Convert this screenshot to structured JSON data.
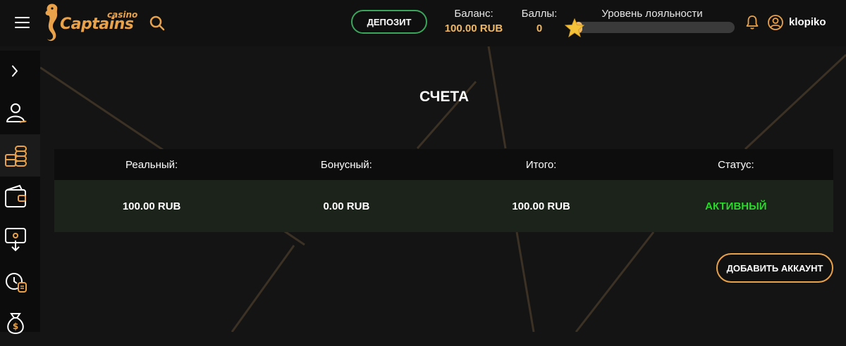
{
  "header": {
    "logo_small": "casino",
    "logo_main": "Captains",
    "deposit_label": "ДЕПОЗИТ",
    "balance_label": "Баланс:",
    "balance_value": "100.00 RUB",
    "points_label": "Баллы:",
    "points_value": "0",
    "loyalty_label": "Уровень лояльности",
    "loyalty_progress_fraction": 0.05,
    "username": "klopiko"
  },
  "sidebar": {
    "items": [
      {
        "icon": "chevron-right-icon"
      },
      {
        "icon": "user-profile-icon"
      },
      {
        "icon": "coins-stack-icon",
        "active": true
      },
      {
        "icon": "wallet-icon"
      },
      {
        "icon": "withdraw-icon"
      },
      {
        "icon": "history-icon"
      },
      {
        "icon": "money-bag-icon"
      }
    ]
  },
  "main": {
    "title": "СЧЕТА",
    "table": {
      "headers": [
        "Реальный:",
        "Бонусный:",
        "Итого:",
        "Статус:"
      ],
      "rows": [
        [
          "100.00 RUB",
          "0.00 RUB",
          "100.00 RUB",
          "АКТИВНЫЙ"
        ]
      ]
    },
    "add_account_label": "ДОБАВИТЬ АККАУНТ"
  },
  "colors": {
    "accent": "#e9a24a",
    "gold_text": "#f0b862",
    "deposit_border": "#3aa55b",
    "status_active": "#2dd62d",
    "row_bg": "#1b231b"
  }
}
